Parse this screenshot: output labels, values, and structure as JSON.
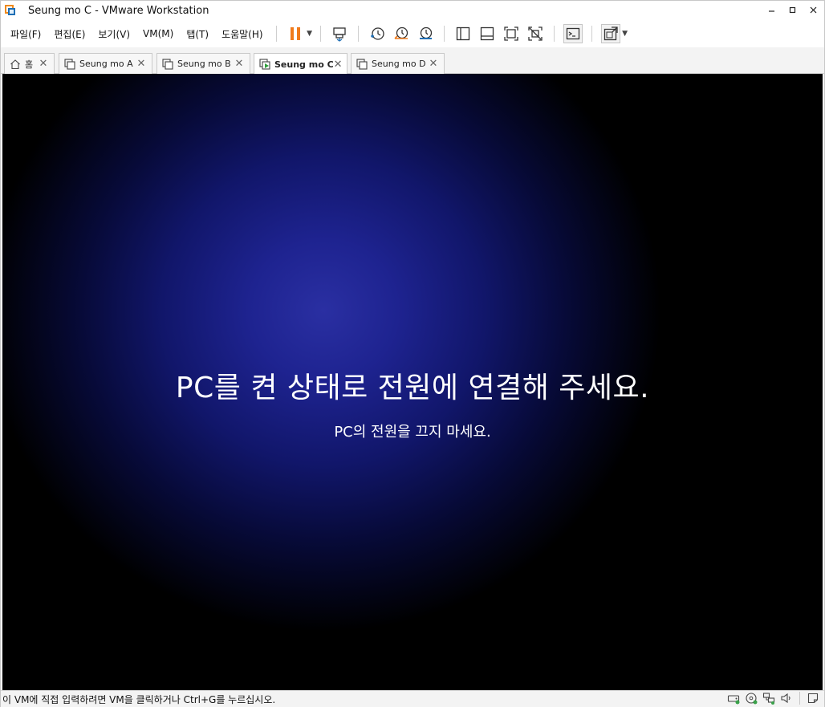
{
  "window": {
    "title": "Seung mo C - VMware Workstation",
    "controls": {
      "minimize": "–",
      "maximize": "□",
      "close": "✕"
    }
  },
  "menu": {
    "items": [
      "파일(F)",
      "편집(E)",
      "보기(V)",
      "VM(M)",
      "탭(T)",
      "도움말(H)"
    ]
  },
  "toolbar": {
    "icons": [
      "pause-icon",
      "send-ctrl-alt-del-icon",
      "snapshot-icon",
      "revert-snapshot-icon",
      "snapshot-manager-icon",
      "library-view-icon",
      "thumbnail-bar-icon",
      "full-screen-icon",
      "unity-icon",
      "console-view-icon",
      "stretch-guest-icon"
    ],
    "accent": "#f07b1c"
  },
  "tabs": [
    {
      "label": "홈",
      "icon": "home-icon",
      "active": false
    },
    {
      "label": "Seung mo A",
      "icon": "vm-icon",
      "active": false
    },
    {
      "label": "Seung mo B",
      "icon": "vm-icon",
      "active": false
    },
    {
      "label": "Seung mo C",
      "icon": "vm-running-icon",
      "active": true
    },
    {
      "label": "Seung mo D",
      "icon": "vm-icon",
      "active": false
    }
  ],
  "vm": {
    "heading": "PC를 켠 상태로 전원에 연결해 주세요.",
    "subheading": "PC의 전원을 끄지 마세요.",
    "colors": {
      "glow": "#2a2fa2",
      "background": "#000000"
    }
  },
  "statusbar": {
    "message": "이 VM에 직접 입력하려면 VM을 클릭하거나 Ctrl+G를 누르십시오.",
    "icons": [
      "hard-disk-icon",
      "cd-dvd-icon",
      "network-icon",
      "sound-icon",
      "message-log-icon"
    ]
  }
}
